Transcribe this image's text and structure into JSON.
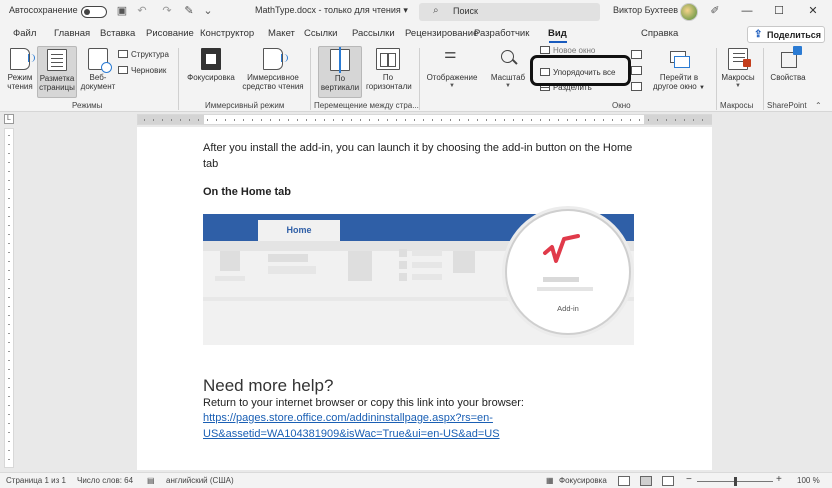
{
  "titlebar": {
    "autosave_label": "Автосохранение",
    "autosave_state": "Откл.",
    "doc_title": "MathType.docx",
    "doc_status": "только для чтения",
    "search_placeholder": "Поиск",
    "user_name": "Виктор Бухтеев",
    "icons": [
      "save-icon",
      "undo-icon",
      "redo-icon",
      "format-painter-icon",
      "qat-customize-icon",
      "pen-icon",
      "minimize-icon",
      "maximize-icon",
      "close-icon"
    ]
  },
  "tabs": [
    "Файл",
    "Главная",
    "Вставка",
    "Рисование",
    "Конструктор",
    "Макет",
    "Ссылки",
    "Рассылки",
    "Рецензирование",
    "Разработчик",
    "Вид",
    "Справка"
  ],
  "active_tab": "Вид",
  "share_label": "Поделиться",
  "ribbon": {
    "views": {
      "read_mode": [
        "Режим",
        "чтения"
      ],
      "print_layout": [
        "Разметка",
        "страницы"
      ],
      "web_layout": [
        "Веб-",
        "документ"
      ],
      "outline": "Структура",
      "draft": "Черновик",
      "group": "Режимы"
    },
    "immersive": {
      "focus": "Фокусировка",
      "reader": [
        "Иммерсивное",
        "средство чтения"
      ],
      "group": "Иммерсивный режим"
    },
    "page_movement": {
      "vertical": [
        "По",
        "вертикали"
      ],
      "side_to_side": [
        "По",
        "горизонтали"
      ],
      "group": "Перемещение между стра..."
    },
    "show": {
      "label": "Отображение"
    },
    "zoom": {
      "label": "Масштаб"
    },
    "window": {
      "new_window": "Новое окно",
      "arrange_all": "Упорядочить все",
      "split": "Разделить",
      "switch": [
        "Перейти в",
        "другое окно"
      ],
      "group": "Окно"
    },
    "macros": {
      "label": "Макросы",
      "group": "Макросы"
    },
    "sharepoint": {
      "label": "Свойства",
      "group": "SharePoint"
    }
  },
  "document": {
    "intro": "After you install the add-in, you can launch it by choosing the add-in button on the Home tab",
    "heading": "On the Home tab",
    "figure": {
      "home_tab": "Home",
      "addin_caption": "Add-in",
      "logo_color": "#e03a4a",
      "bar_color": "#2f5fa7"
    },
    "help_heading": "Need more help?",
    "help_text": "Return to your internet browser or copy this link into your browser:",
    "link_line1": "https://pages.store.office.com/addininstallpage.aspx?rs=en-",
    "link_line2": "US&assetid=WA104381909&isWac=True&ui=en-US&ad=US"
  },
  "statusbar": {
    "page": "Страница 1 из 1",
    "words": "Число слов: 64",
    "language": "английский (США)",
    "focus": "Фокусировка",
    "zoom_minus": "−",
    "zoom_plus": "+",
    "zoom_level": "100 %"
  }
}
